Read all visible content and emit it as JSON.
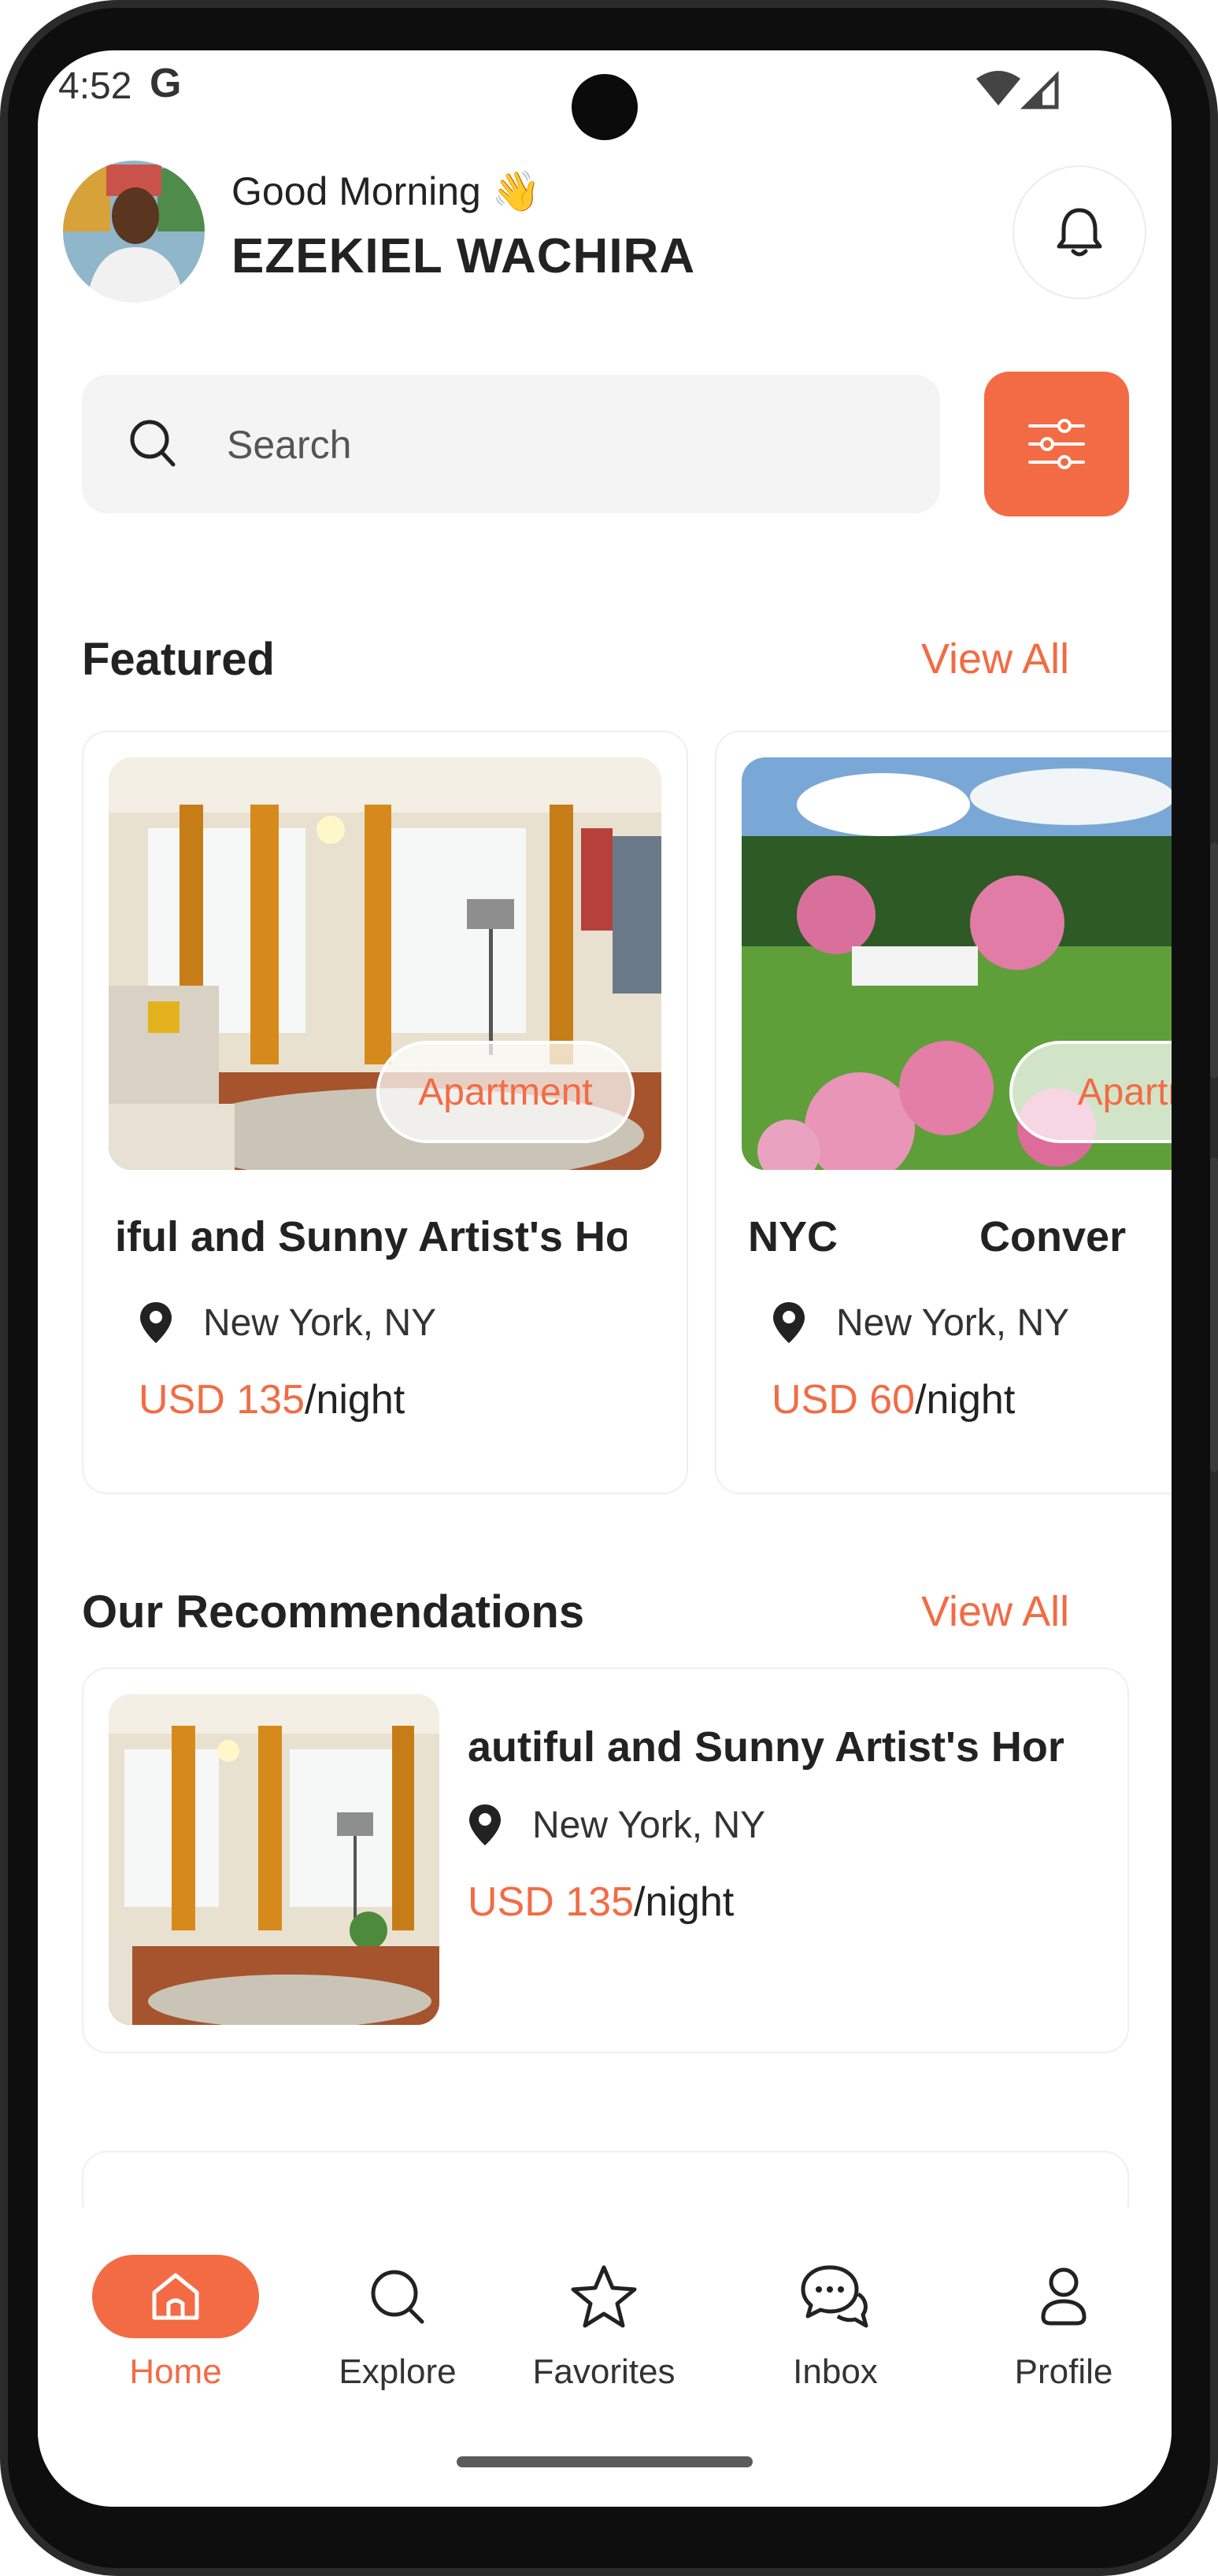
{
  "status_bar": {
    "time": "4:52",
    "google_g": "G"
  },
  "header": {
    "greeting": "Good Morning 👋",
    "user_name": "EZEKIEL WACHIRA"
  },
  "search": {
    "placeholder": "Search"
  },
  "featured": {
    "title": "Featured",
    "view_all": "View All",
    "cards": [
      {
        "badge": "Apartment",
        "title": "iful and Sunny Artist's Ho",
        "location": "New York, NY",
        "price": "USD 135",
        "unit": "/night"
      },
      {
        "badge": "Apartm",
        "title": "NYC            Conver",
        "location": "New York, NY",
        "price": "USD 60",
        "unit": "/night"
      }
    ]
  },
  "recommendations": {
    "title": "Our Recommendations",
    "view_all": "View All",
    "items": [
      {
        "title": "autiful and Sunny Artist's Hor",
        "location": "New York, NY",
        "price": "USD 135",
        "unit": "/night"
      }
    ]
  },
  "bottom_nav": {
    "items": [
      {
        "label": "Home",
        "icon": "home-icon",
        "active": true
      },
      {
        "label": "Explore",
        "icon": "search-icon",
        "active": false
      },
      {
        "label": "Favorites",
        "icon": "star-icon",
        "active": false
      },
      {
        "label": "Inbox",
        "icon": "chat-icon",
        "active": false
      },
      {
        "label": "Profile",
        "icon": "user-icon",
        "active": false
      }
    ]
  },
  "colors": {
    "accent": "#f36b44",
    "text": "#222222",
    "card_border": "#efefef",
    "search_bg": "#f4f4f4"
  }
}
